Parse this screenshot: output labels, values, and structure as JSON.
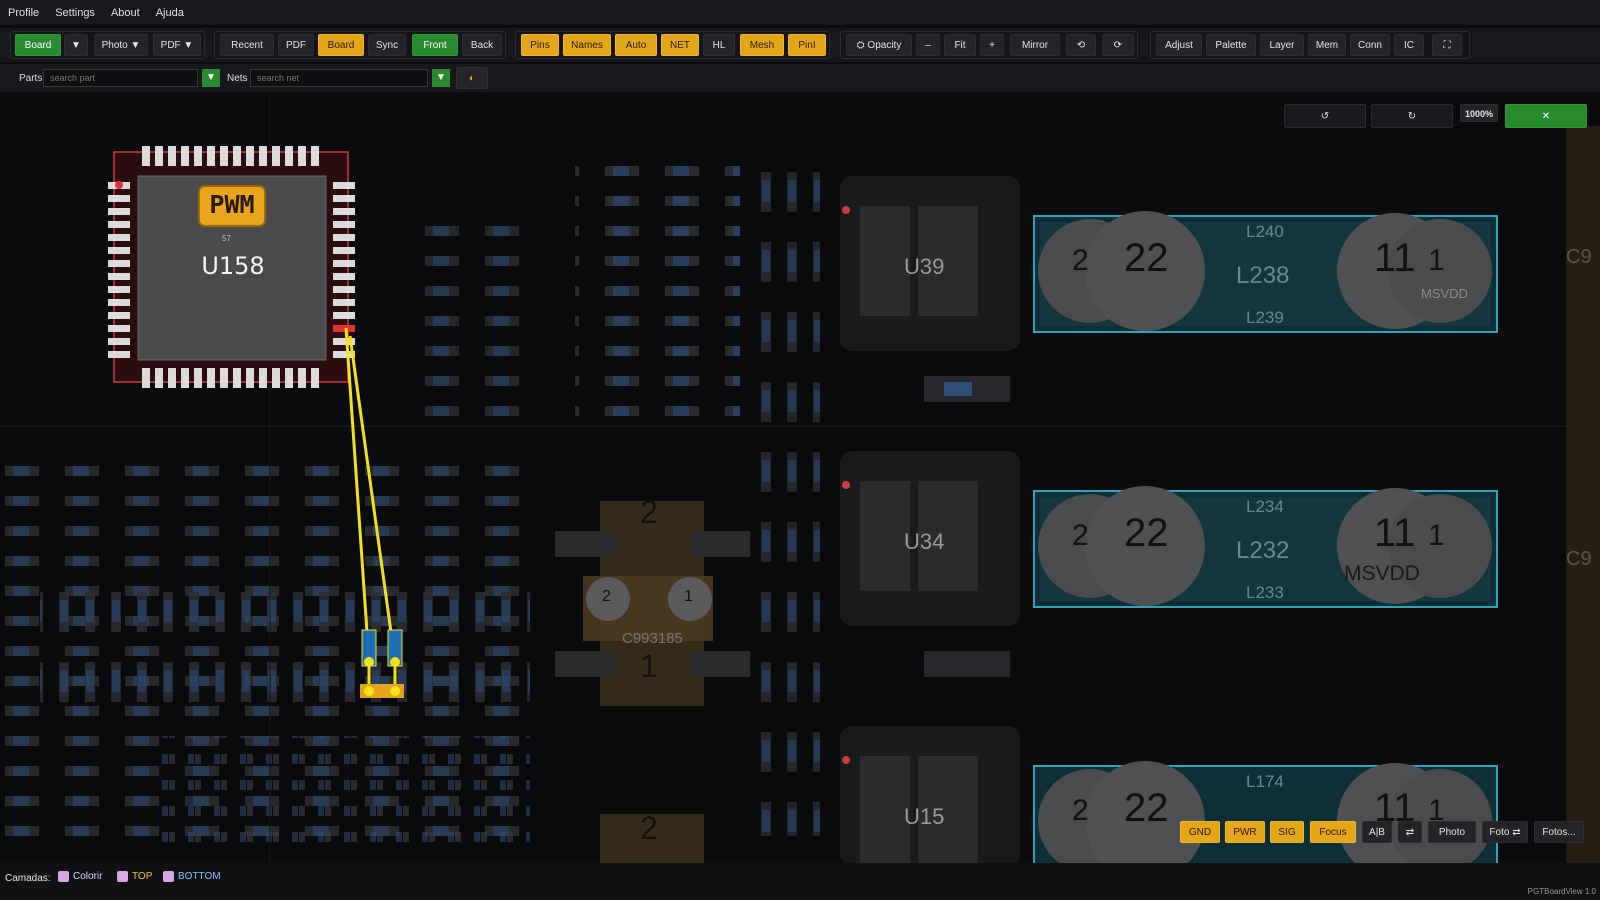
{
  "menu": [
    "Profile",
    "Settings",
    "About",
    "Ajuda"
  ],
  "toolbar": {
    "board": "Board",
    "board_drop": "▼",
    "photo": "Photo ▼",
    "pdf": "PDF ▼",
    "recent": "Recent",
    "pdf2": "PDF",
    "board2": "Board",
    "sync": "Sync",
    "front": "Front",
    "back": "Back",
    "pins": "Pins",
    "names": "Names",
    "auto": "Auto",
    "net": "NET",
    "hl": "HL",
    "mesh": "Mesh",
    "pinl": "PinI",
    "opacity": "⛭ Opacity",
    "minus": "–",
    "fit": "Fit",
    "plus": "+",
    "mirror": "Mirror",
    "rot_left": "⟲",
    "rot_right": "⟳",
    "adjust": "Adjust",
    "palette": "Palette",
    "layer": "Layer",
    "mem": "Mem",
    "conn": "Conn",
    "ic": "IC",
    "full": "⛶"
  },
  "search": {
    "parts_label": "Parts",
    "parts_placeholder": "search part",
    "nets_label": "Nets",
    "nets_placeholder": "search net",
    "drop": "▼",
    "toggle": "◐"
  },
  "view_controls": {
    "rot_ccw": "↺",
    "rot_cw": "↻",
    "zoom": "1000%",
    "close": "✕"
  },
  "board": {
    "ic_main": {
      "designator": "U158",
      "badge": "PWM",
      "sub": "57"
    },
    "ic_u39": "U39",
    "ic_u34": "U34",
    "ic_u15": "U15",
    "coils": [
      {
        "top": "L240",
        "mid": "L238",
        "bot": "L239",
        "pin_a": "2",
        "pin_a2": "22",
        "pin_b": "11",
        "pin_b2": "1",
        "net": "MSVDD"
      },
      {
        "top": "L234",
        "mid": "L232",
        "bot": "L233",
        "pin_a": "2",
        "pin_a2": "22",
        "pin_b": "11",
        "pin_b2": "1",
        "net": "MSVDD"
      },
      {
        "top": "L174",
        "mid": "",
        "bot": "",
        "pin_a": "2",
        "pin_a2": "22",
        "pin_b": "11",
        "pin_b2": "1",
        "net": ""
      }
    ],
    "cap": {
      "label": "C993185",
      "pin_top": "2",
      "pin_l": "2",
      "pin_r": "1",
      "pin_bottom": "1"
    },
    "bottom_big_pin": "2",
    "edge_labels": [
      "C9",
      "C9"
    ]
  },
  "bottom_toolbar": [
    "GND",
    "PWR",
    "SIG",
    "Focus",
    "A|B",
    "⇄",
    "Photo",
    "Foto ⇄",
    "Fotos..."
  ],
  "status": {
    "layers_label": "Camadas:",
    "layers": [
      "Colorir",
      "TOP",
      "BOTTOM"
    ],
    "app": "PGTBoardView 1.0"
  },
  "colors": {
    "accent_green": "#2a8a2f",
    "accent_yellow": "#e3a619",
    "trace": "#f2e21a",
    "ic_outline": "#d23a3a"
  }
}
